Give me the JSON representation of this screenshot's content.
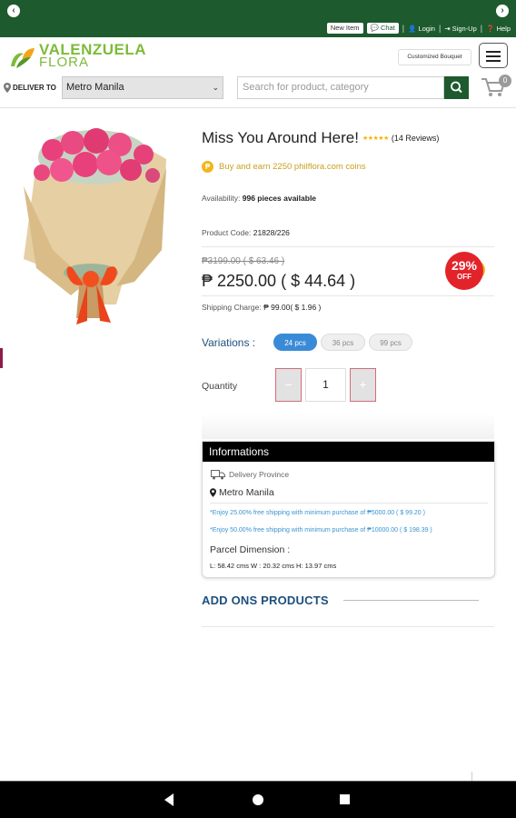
{
  "topbar": {
    "new_item": "New Item",
    "chat": "Chat",
    "login": "Login",
    "signup": "Sign-Up",
    "help": "Help"
  },
  "header": {
    "logo_line1": "VALENZUELA",
    "logo_line2": "FLORA",
    "customized_bouquet": "Customized Bouquet",
    "deliver_to_label": "DELIVER TO",
    "deliver_to_value": "Metro Manila",
    "search_placeholder": "Search for product, category",
    "cart_count": "0"
  },
  "product": {
    "title": "Miss You Around Here!",
    "stars": "★★★★★",
    "rating": 5,
    "reviews": "(14 Reviews)",
    "coins_text": "Buy and earn 2250 philflora.com coins",
    "availability_label": "Availability:",
    "availability_value": "996 pieces available",
    "code_label": "Product Code:",
    "code_value": "21828/226",
    "old_price": "₱3199.00 ( $ 63.46 )",
    "price": "₱ 2250.00 ( $ 44.64 )",
    "discount_pct": "29%",
    "discount_off": "OFF",
    "shipping_label": "Shipping Charge:",
    "shipping_value": "₱ 99.00( $ 1.96 )",
    "variations_label": "Variations :",
    "variations": [
      "24 pcs",
      "36 pcs",
      "99 pcs"
    ],
    "selected_variation": "24 pcs",
    "quantity_label": "Quantity",
    "quantity_minus": "−",
    "quantity_value": "1",
    "quantity_plus": "+"
  },
  "info": {
    "heading": "Informations",
    "delivery_province_label": "Delivery Province",
    "delivery_province_value": "Metro Manila",
    "promo1": "*Enjoy 25.00% free shipping with minimum purchase of ₱5000.00 ( $ 99.20 )",
    "promo2": "*Enjoy 50.00% free shipping with minimum purchase of ₱10000.00 ( $ 198.39 )",
    "parcel_label": "Parcel Dimension :",
    "parcel_dims": "L: 58.42 cms  W : 20.32 cms  H: 13.97 cms"
  },
  "addons": {
    "heading": "ADD ONS PRODUCTS"
  },
  "colors": {
    "brand_green": "#1d5a2e",
    "logo_green": "#7dbb3a",
    "accent_blue": "#3a8bd7",
    "discount_red": "#e3232a",
    "coin_gold": "#f2b51c"
  }
}
